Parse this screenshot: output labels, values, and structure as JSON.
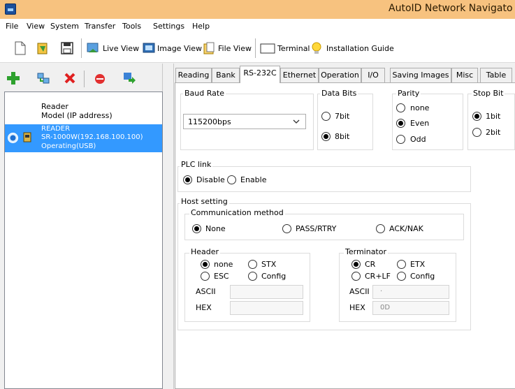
{
  "window": {
    "title": "AutoID Network Navigato"
  },
  "menu": [
    "File",
    "View",
    "System",
    "Transfer",
    "Tools",
    "Settings",
    "Help"
  ],
  "toolbar": {
    "live_view": "Live View",
    "image_view": "Image View",
    "file_view": "File View",
    "terminal": "Terminal",
    "installation_guide": "Installation Guide"
  },
  "device_list": {
    "header_line1": "Reader",
    "header_line2": "Model (IP address)",
    "items": [
      {
        "name": "READER",
        "model": "SR-1000W(192.168.100.100)",
        "status": "Operating(USB)"
      }
    ]
  },
  "tabs": [
    "Reading",
    "Bank",
    "RS-232C",
    "Ethernet",
    "Operation",
    "I/O",
    "Saving Images",
    "Misc",
    "Table"
  ],
  "active_tab": "RS-232C",
  "rs232c": {
    "baud_rate": {
      "label": "Baud Rate",
      "value": "115200bps"
    },
    "data_bits": {
      "label": "Data Bits",
      "options": [
        "7bit",
        "8bit"
      ],
      "selected": "8bit"
    },
    "parity": {
      "label": "Parity",
      "options": [
        "none",
        "Even",
        "Odd"
      ],
      "selected": "Even"
    },
    "stop_bit": {
      "label": "Stop Bit",
      "options": [
        "1bit",
        "2bit"
      ],
      "selected": "1bit"
    },
    "plc_link": {
      "label": "PLC link",
      "options": [
        "Disable",
        "Enable"
      ],
      "selected": "Disable"
    },
    "host_setting": {
      "label": "Host setting",
      "communication_method": {
        "label": "Communication method",
        "options": [
          "None",
          "PASS/RTRY",
          "ACK/NAK"
        ],
        "selected": "None"
      },
      "header": {
        "label": "Header",
        "options": [
          "none",
          "STX",
          "ESC",
          "Config"
        ],
        "selected": "none",
        "ascii_label": "ASCII",
        "hex_label": "HEX",
        "ascii": "",
        "hex": ""
      },
      "terminator": {
        "label": "Terminator",
        "options": [
          "CR",
          "ETX",
          "CR+LF",
          "Config"
        ],
        "selected": "CR",
        "ascii_label": "ASCII",
        "hex_label": "HEX",
        "ascii": "·",
        "hex": "0D"
      }
    }
  }
}
